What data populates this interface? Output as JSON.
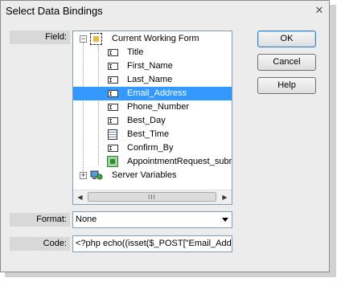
{
  "window": {
    "title": "Select Data Bindings"
  },
  "labels": {
    "field": "Field:",
    "format": "Format:",
    "code": "Code:"
  },
  "tree": {
    "root_label": "Current Working Form",
    "root_expander": "−",
    "items": [
      {
        "label": "Title",
        "icon": "text-field-icon"
      },
      {
        "label": "First_Name",
        "icon": "text-field-icon"
      },
      {
        "label": "Last_Name",
        "icon": "text-field-icon"
      },
      {
        "label": "Email_Address",
        "icon": "text-field-icon",
        "selected": true
      },
      {
        "label": "Phone_Number",
        "icon": "text-field-icon"
      },
      {
        "label": "Best_Day",
        "icon": "text-field-icon"
      },
      {
        "label": "Best_Time",
        "icon": "list-field-icon"
      },
      {
        "label": "Confirm_By",
        "icon": "text-field-icon"
      },
      {
        "label": "AppointmentRequest_subm",
        "icon": "submit-button-icon"
      }
    ],
    "server_label": "Server Variables",
    "server_expander": "+",
    "scroll_thumb": "III"
  },
  "buttons": {
    "ok": "OK",
    "cancel": "Cancel",
    "help": "Help"
  },
  "format": {
    "selected": "None"
  },
  "code": {
    "value": "<?php echo((isset($_POST[\"Email_Addre"
  },
  "colors": {
    "selection": "#3399ff",
    "label_bar": "#d8d8d8",
    "dialog_bg": "#ececec"
  }
}
